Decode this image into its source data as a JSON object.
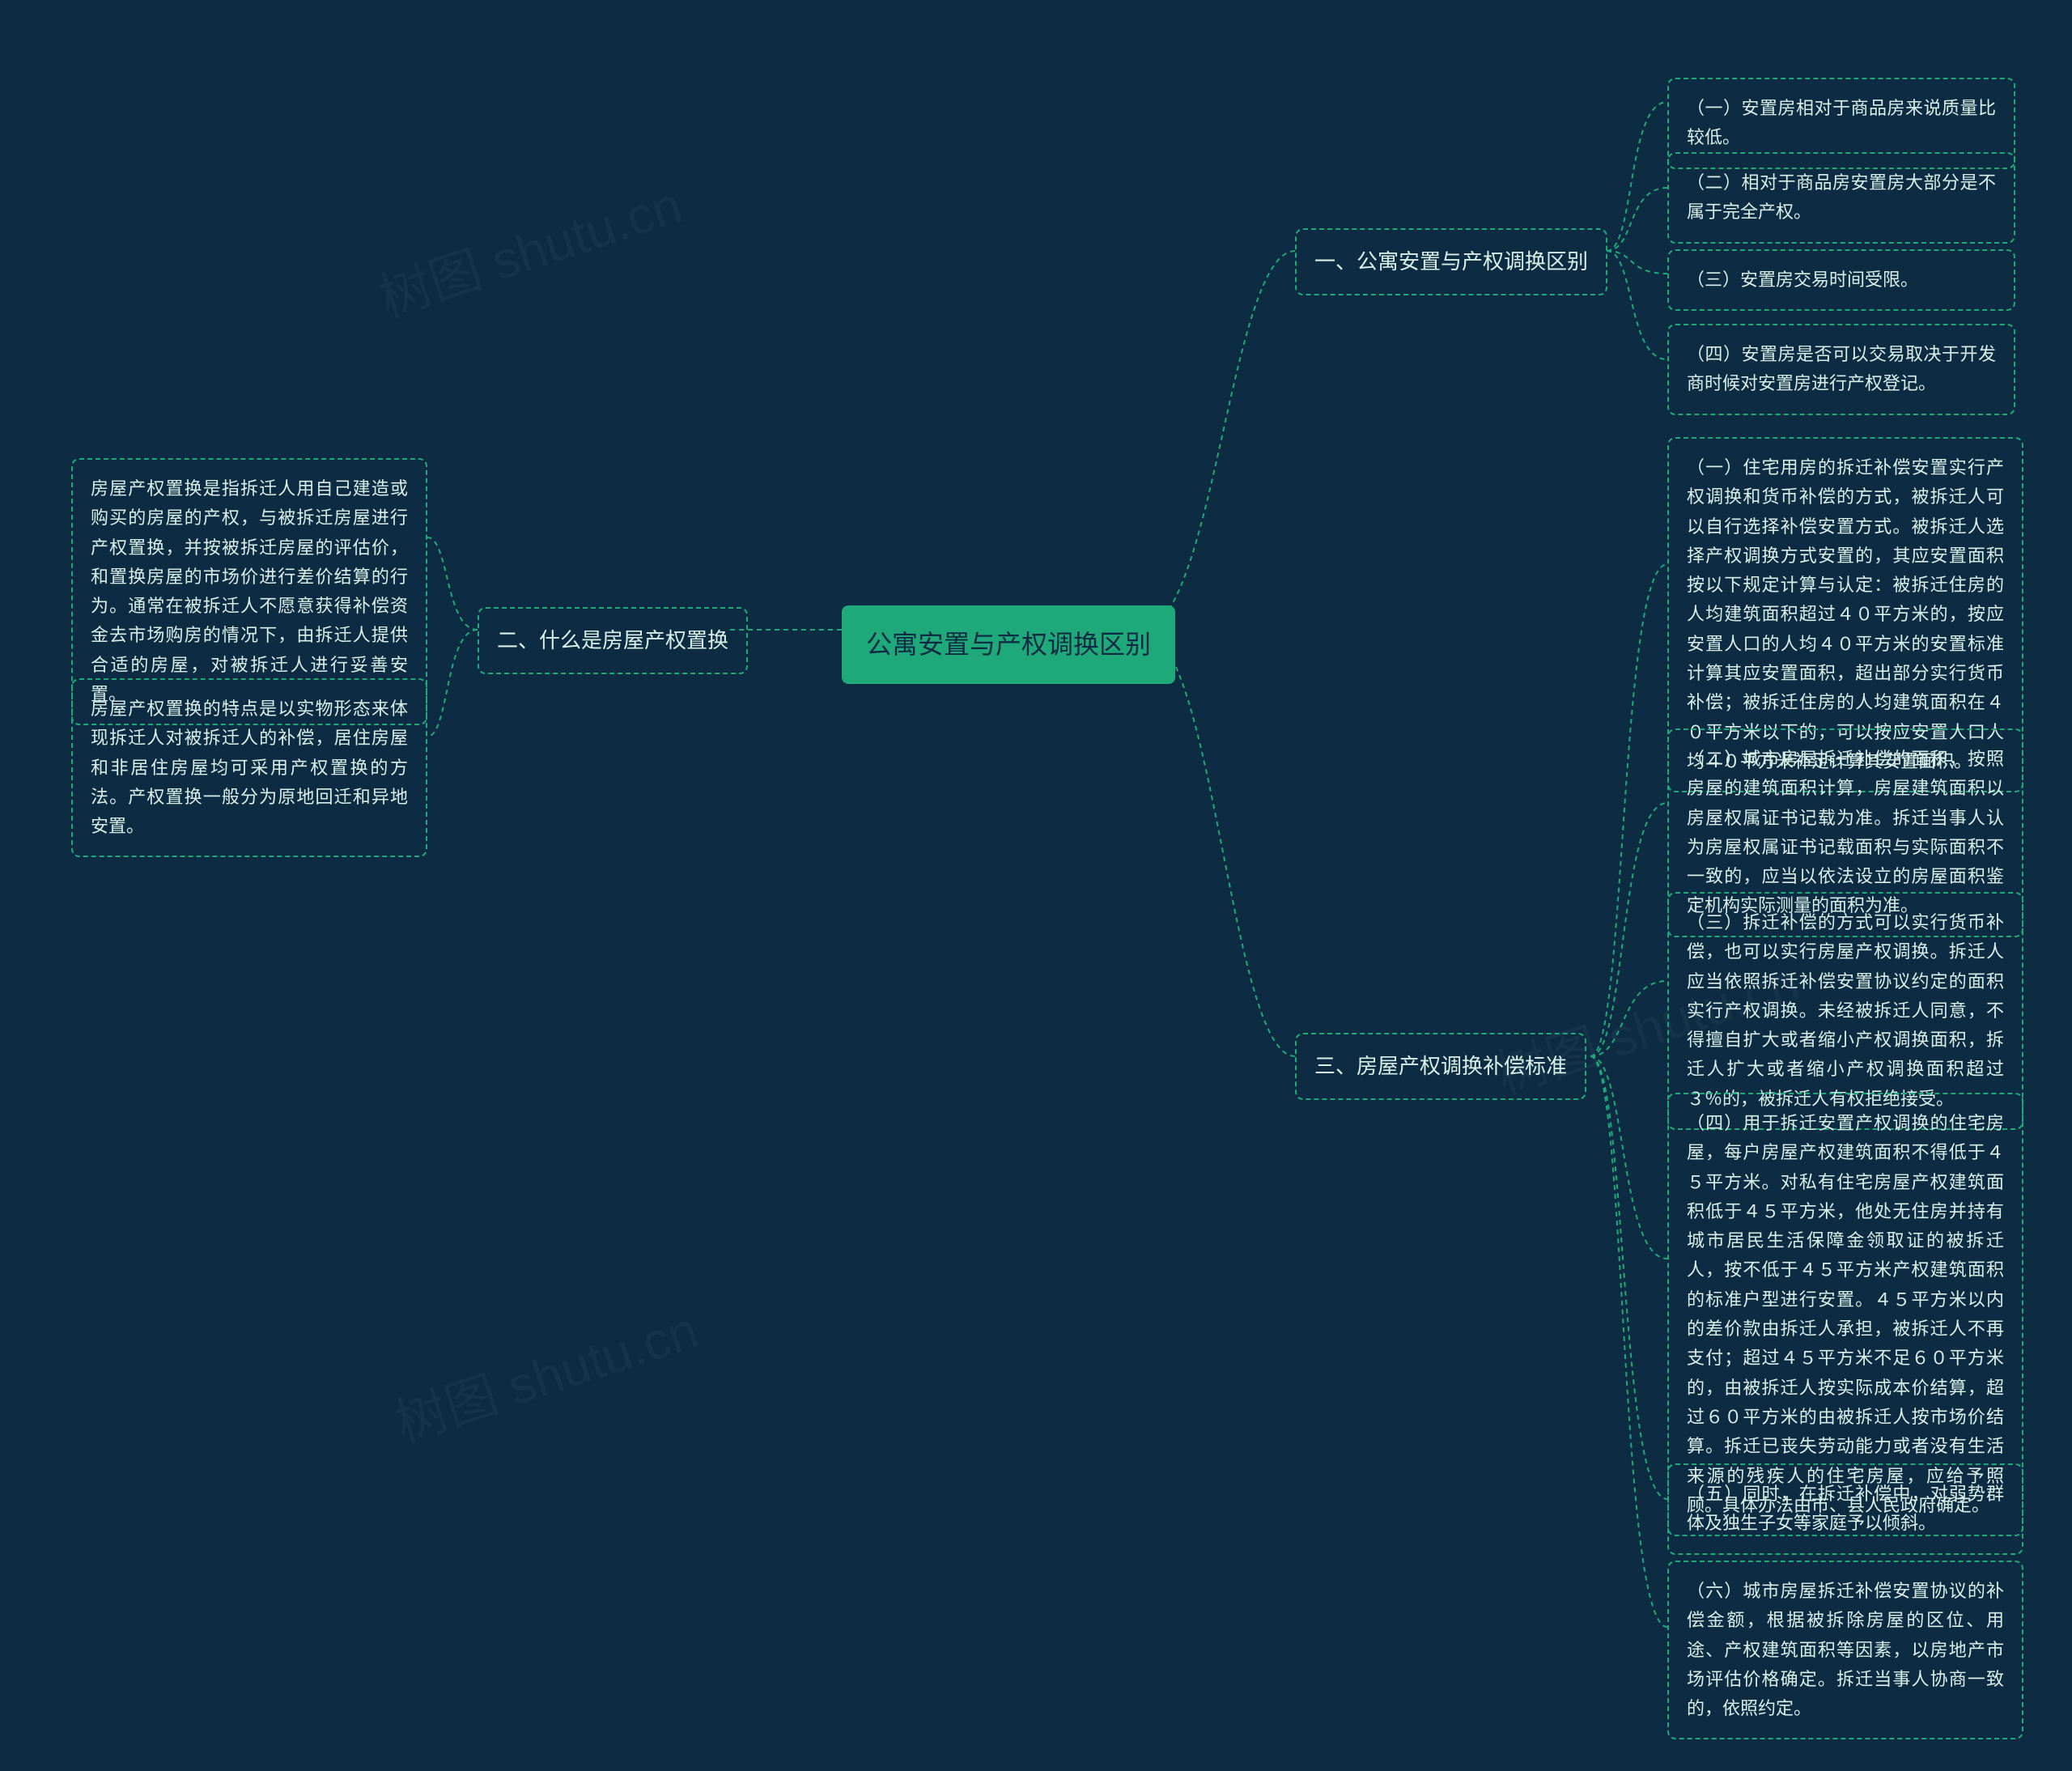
{
  "watermark": "树图 shutu.cn",
  "center": {
    "label": "公寓安置与产权调换区别"
  },
  "left": {
    "branch2": {
      "label": "二、什么是房屋产权置换",
      "leaves": [
        "房屋产权置换是指拆迁人用自己建造或购买的房屋的产权，与被拆迁房屋进行产权置换，并按被拆迁房屋的评估价，和置换房屋的市场价进行差价结算的行为。通常在被拆迁人不愿意获得补偿资金去市场购房的情况下，由拆迁人提供合适的房屋，对被拆迁人进行妥善安置。",
        "房屋产权置换的特点是以实物形态来体现拆迁人对被拆迁人的补偿，居住房屋和非居住房屋均可采用产权置换的方法。产权置换一般分为原地回迁和异地安置。"
      ]
    }
  },
  "right": {
    "branch1": {
      "label": "一、公寓安置与产权调换区别",
      "leaves": [
        "（一）安置房相对于商品房来说质量比较低。",
        "（二）相对于商品房安置房大部分是不属于完全产权。",
        "（三）安置房交易时间受限。",
        "（四）安置房是否可以交易取决于开发商时候对安置房进行产权登记。"
      ]
    },
    "branch3": {
      "label": "三、房屋产权调换补偿标准",
      "leaves": [
        "（一）住宅用房的拆迁补偿安置实行产权调换和货币补偿的方式，被拆迁人可以自行选择补偿安置方式。被拆迁人选择产权调换方式安置的，其应安置面积按以下规定计算与认定：被拆迁住房的人均建筑面积超过４０平方米的，按应安置人口的人均４０平方米的安置标准计算其应安置面积，超出部分实行货币补偿；被拆迁住房的人均建筑面积在４０平方米以下的，可以按应安置人口人均４０平方米补足计算其安置面积。",
        "（二）城市房屋拆迁补偿的面积，按照房屋的建筑面积计算，房屋建筑面积以房屋权属证书记载为准。拆迁当事人认为房屋权属证书记载面积与实际面积不一致的，应当以依法设立的房屋面积鉴定机构实际测量的面积为准。",
        "（三）拆迁补偿的方式可以实行货币补偿，也可以实行房屋产权调换。拆迁人应当依照拆迁补偿安置协议约定的面积实行产权调换。未经被拆迁人同意，不得擅自扩大或者缩小产权调换面积，拆迁人扩大或者缩小产权调换面积超过３％的，被拆迁人有权拒绝接受。",
        "（四）用于拆迁安置产权调换的住宅房屋，每户房屋产权建筑面积不得低于４５平方米。对私有住宅房屋产权建筑面积低于４５平方米，他处无住房并持有城市居民生活保障金领取证的被拆迁人，按不低于４５平方米产权建筑面积的标准户型进行安置。４５平方米以内的差价款由拆迁人承担，被拆迁人不再支付；超过４５平方米不足６０平方米的，由被拆迁人按实际成本价结算，超过６０平方米的由被拆迁人按市场价结算。拆迁已丧失劳动能力或者没有生活来源的残疾人的住宅房屋，应给予照顾。具体办法由市、县人民政府确定。",
        "（五）同时，在拆迁补偿中，对弱势群体及独生子女等家庭予以倾斜。",
        "（六）城市房屋拆迁补偿安置协议的补偿金额，根据被拆除房屋的区位、用途、产权建筑面积等因素，以房地产市场评估价格确定。拆迁当事人协商一致的，依照约定。"
      ]
    }
  }
}
